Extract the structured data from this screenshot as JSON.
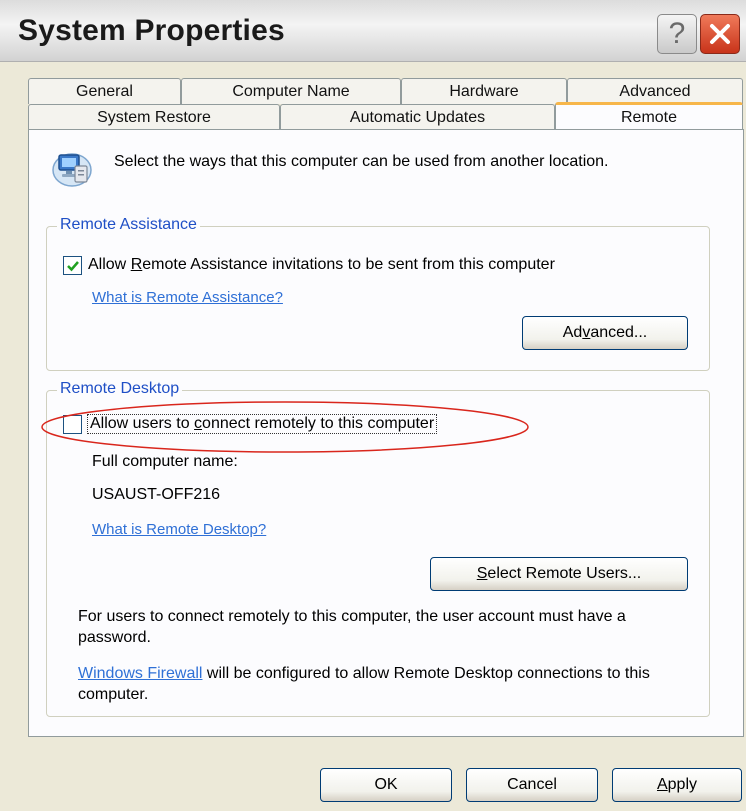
{
  "window": {
    "title": "System Properties"
  },
  "tabs": {
    "row1": [
      {
        "label": "General"
      },
      {
        "label": "Computer Name"
      },
      {
        "label": "Hardware"
      },
      {
        "label": "Advanced"
      }
    ],
    "row2": [
      {
        "label": "System Restore"
      },
      {
        "label": "Automatic Updates"
      },
      {
        "label": "Remote"
      }
    ]
  },
  "intro": {
    "text": "Select the ways that this computer can be used from another location."
  },
  "remote_assistance": {
    "legend": "Remote Assistance",
    "checkbox_checked": true,
    "checkbox_label_pre": "Allow ",
    "checkbox_label_accel": "R",
    "checkbox_label_post": "emote Assistance invitations to be sent from this computer",
    "help_link": "What is Remote Assistance?",
    "advanced_pre": "Ad",
    "advanced_accel": "v",
    "advanced_post": "anced..."
  },
  "remote_desktop": {
    "legend": "Remote Desktop",
    "checkbox_checked": false,
    "checkbox_label_pre": "Allow users to ",
    "checkbox_label_accel": "c",
    "checkbox_label_post": "onnect remotely to this computer",
    "full_name_label": "Full computer name:",
    "computer_name": "USAUST-OFF216",
    "help_link": "What is Remote Desktop?",
    "select_users_accel": "S",
    "select_users_post": "elect Remote Users...",
    "password_note": "For users to connect remotely to this computer, the user account must have a password.",
    "firewall_link": "Windows Firewall",
    "firewall_note": " will be configured to allow Remote Desktop connections to this computer."
  },
  "buttons": {
    "ok": "OK",
    "cancel": "Cancel",
    "apply_accel": "A",
    "apply_post": "pply"
  },
  "colors": {
    "highlight_ellipse": "#d9261c",
    "legend_blue": "#1f4fc6",
    "link_blue": "#2f70d6"
  }
}
